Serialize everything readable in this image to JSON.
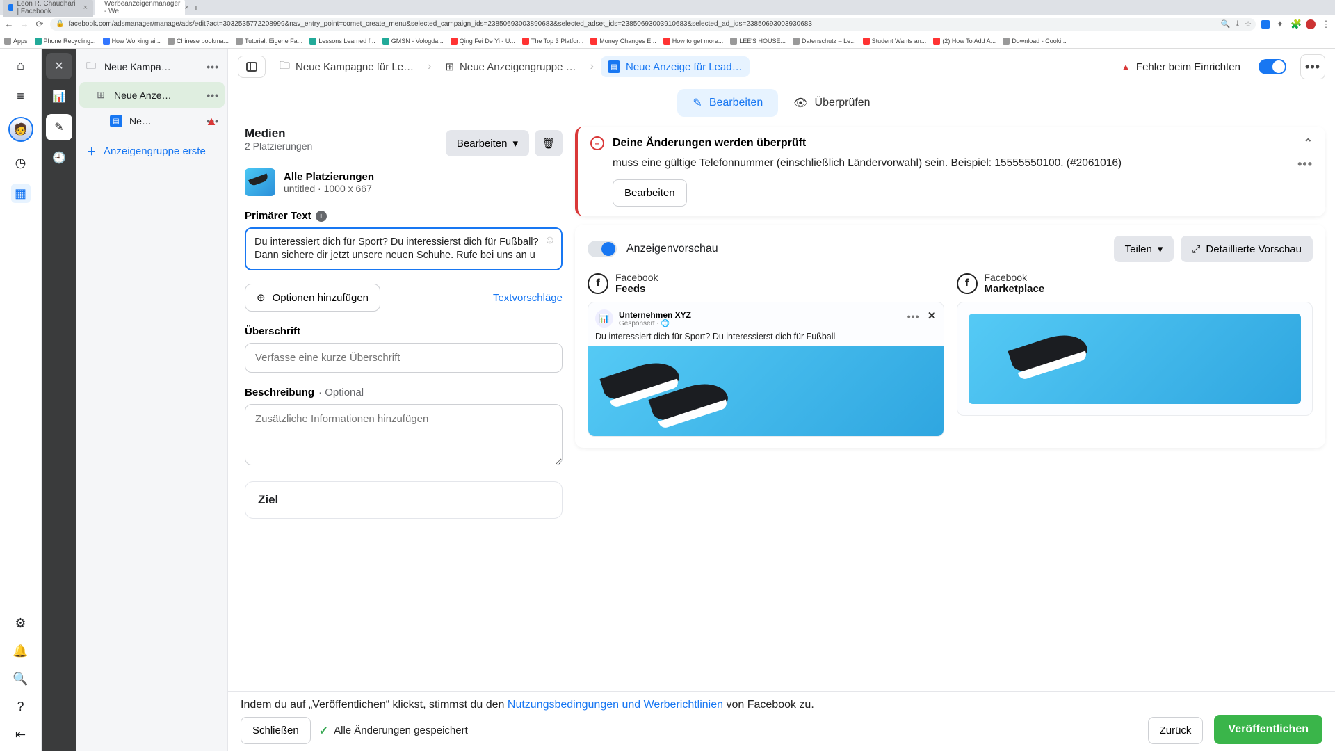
{
  "chrome": {
    "tabs": [
      {
        "title": "Leon R. Chaudhari | Facebook"
      },
      {
        "title": "Werbeanzeigenmanager - We"
      }
    ],
    "url": "facebook.com/adsmanager/manage/ads/edit?act=3032535772208999&nav_entry_point=comet_create_menu&selected_campaign_ids=23850693003890683&selected_adset_ids=23850693003910683&selected_ad_ids=23850693003930683",
    "bookmarks": [
      "Apps",
      "Phone Recycling...",
      "How Working ai...",
      "Chinese bookma...",
      "Tutorial: Eigene Fa...",
      "Lessons Learned f...",
      "GMSN - Vologda...",
      "Qing Fei De Yi - U...",
      "The Top 3 Platfor...",
      "Money Changes E...",
      "How to get more...",
      "LEE'S HOUSE...",
      "Datenschutz – Le...",
      "Student Wants an...",
      "(2) How To Add A...",
      "Download - Cooki..."
    ]
  },
  "breadcrumbs": {
    "panel_toggle": "panel",
    "campaign": "Neue Kampagne für Le…",
    "adset": "Neue Anzeigengruppe …",
    "ad": "Neue Anzeige für Lead…",
    "error": "Fehler beim Einrichten"
  },
  "tree": {
    "campaign": "Neue Kampa…",
    "adset": "Neue Anze…",
    "ad": "Ne…",
    "add_group": "Anzeigengruppe erste"
  },
  "tabs": {
    "edit": "Bearbeiten",
    "review": "Überprüfen"
  },
  "media": {
    "title": "Medien",
    "sub": "2 Platzierungen",
    "edit": "Bearbeiten",
    "all": "Alle Platzierungen",
    "meta": "untitled · 1000 x 667"
  },
  "primary_text": {
    "label": "Primärer Text",
    "value": "Du interessiert dich für Sport? Du interessierst dich für Fußball? Dann sichere dir jetzt unsere neuen Schuhe. Rufe bei uns an u",
    "add_options": "Optionen hinzufügen",
    "suggestions": "Textvorschläge"
  },
  "headline": {
    "label": "Überschrift",
    "placeholder": "Verfasse eine kurze Überschrift"
  },
  "description": {
    "label": "Beschreibung",
    "optional": "Optional",
    "placeholder": "Zusätzliche Informationen hinzufügen"
  },
  "goal": {
    "title": "Ziel"
  },
  "alert": {
    "title": "Deine Änderungen werden überprüft",
    "body": "muss eine gültige Telefonnummer (einschließlich Ländervorwahl) sein. Beispiel: 15555550100. (#2061016)",
    "edit": "Bearbeiten"
  },
  "preview": {
    "toggle_label": "Anzeigenvorschau",
    "share": "Teilen",
    "detail": "Detaillierte Vorschau",
    "feeds": {
      "app": "Facebook",
      "name": "Feeds"
    },
    "marketplace": {
      "app": "Facebook",
      "name": "Marketplace"
    },
    "ad": {
      "page": "Unternehmen XYZ",
      "sponsored": "Gesponsert · 🌐",
      "text": "Du interessiert dich für Sport? Du interessierst dich für Fußball"
    }
  },
  "footer": {
    "terms_pre": "Indem du auf „Veröffentlichen“ klickst, stimmst du den ",
    "terms_link": "Nutzungsbedingungen und Werberichtlinien",
    "terms_post": " von Facebook zu.",
    "close": "Schließen",
    "saved": "Alle Änderungen gespeichert",
    "back": "Zurück",
    "publish": "Veröffentlichen"
  }
}
